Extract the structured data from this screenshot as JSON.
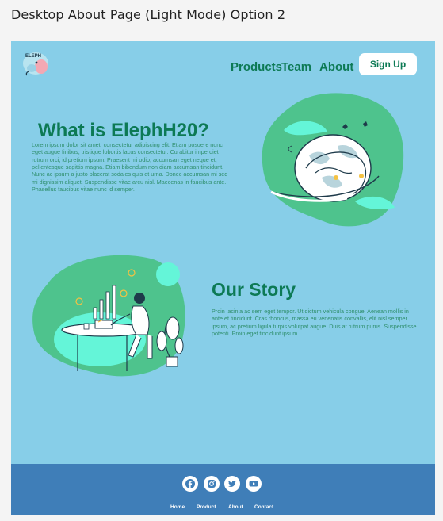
{
  "canvas_title": "Desktop About Page (Light Mode) Option 2",
  "header": {
    "logo_text": "ELEPH",
    "nav": [
      "Products",
      "Team",
      "About"
    ],
    "signup_label": "Sign Up"
  },
  "section_about": {
    "title": "What is ElephH20?",
    "body": "Lorem ipsum dolor sit amet, consectetur adipiscing elit. Etiam posuere nunc eget augue finibus, tristique lobortis lacus consectetur. Curabitur imperdiet rutrum orci, id pretium ipsum. Praesent mi odio, accumsan eget neque et, pellentesque sagittis magna. Etiam bibendum non diam accumsan tincidunt. Nunc ac ipsum a justo placerat sodales quis et urna. Donec accumsan mi sed mi dignissim aliquet. Suspendisse vitae arcu nisl. Maecenas in faucibus ante. Phasellus faucibus vitae nunc id semper."
  },
  "section_story": {
    "title": "Our Story",
    "body": "Proin lacinia ac sem eget tempor. Ut dictum vehicula congue. Aenean mollis in ante et tincidunt. Cras rhoncus, massa eu venenatis convallis, elit nisl semper ipsum, ac pretium ligula turpis volutpat augue. Duis at rutrum purus. Suspendisse potenti. Proin eget tincidunt ipsum."
  },
  "footer": {
    "social_icons": [
      "facebook-icon",
      "instagram-icon",
      "twitter-icon",
      "youtube-icon"
    ],
    "links": [
      "Home",
      "Product",
      "About",
      "Contact"
    ]
  },
  "colors": {
    "page_bg": "#87cee8",
    "accent_green": "#0d7a55",
    "blob_green": "#4ec38d",
    "mint": "#64f5d8",
    "footer_blue": "#3f7eb8"
  }
}
